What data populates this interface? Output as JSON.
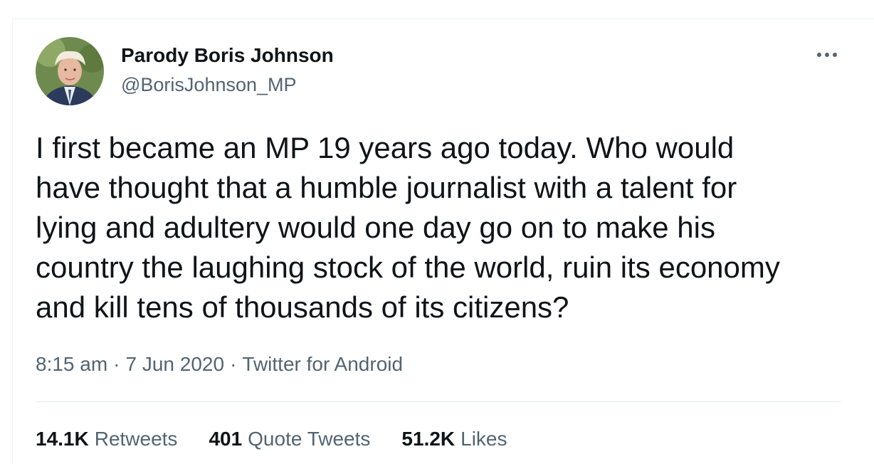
{
  "colors": {
    "text_primary": "#0f1419",
    "text_secondary": "#536471",
    "divider": "#e6ecf0",
    "background": "#ffffff"
  },
  "author": {
    "avatar_icon": "profile-photo",
    "display_name": "Parody Boris Johnson",
    "handle": "@BorisJohnson_MP"
  },
  "more_icon": "more-dots-icon",
  "tweet": {
    "text": "I first became an MP 19 years ago today. Who would\nhave thought that a humble journalist with a talent for\nlying and adultery would one day go on to make his\ncountry the laughing stock of the world, ruin its economy\nand kill tens of thousands of its citizens?",
    "time": "8:15 am",
    "separator": "·",
    "date": "7 Jun 2020",
    "source": "Twitter for Android"
  },
  "stats": {
    "retweets": {
      "count": "14.1K",
      "label": "Retweets"
    },
    "quote_tweets": {
      "count": "401",
      "label": "Quote Tweets"
    },
    "likes": {
      "count": "51.2K",
      "label": "Likes"
    }
  }
}
